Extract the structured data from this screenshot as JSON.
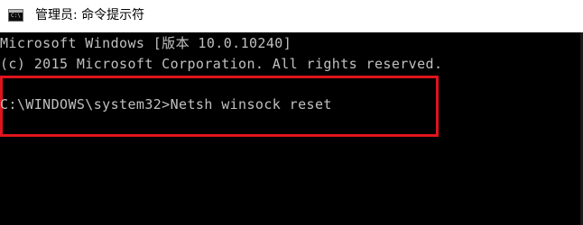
{
  "window": {
    "title": "管理员: 命令提示符",
    "icon": "cmd-icon",
    "icon_glyph": "C:\\"
  },
  "console": {
    "lines": [
      "Microsoft Windows [版本 10.0.10240]",
      "(c) 2015 Microsoft Corporation. All rights reserved.",
      "C:\\WINDOWS\\system32>Netsh winsock reset"
    ]
  },
  "colors": {
    "console_background": "#000000",
    "console_text": "#c0c0c0",
    "highlight_border": "#e0141e",
    "titlebar_background": "#ffffff"
  }
}
